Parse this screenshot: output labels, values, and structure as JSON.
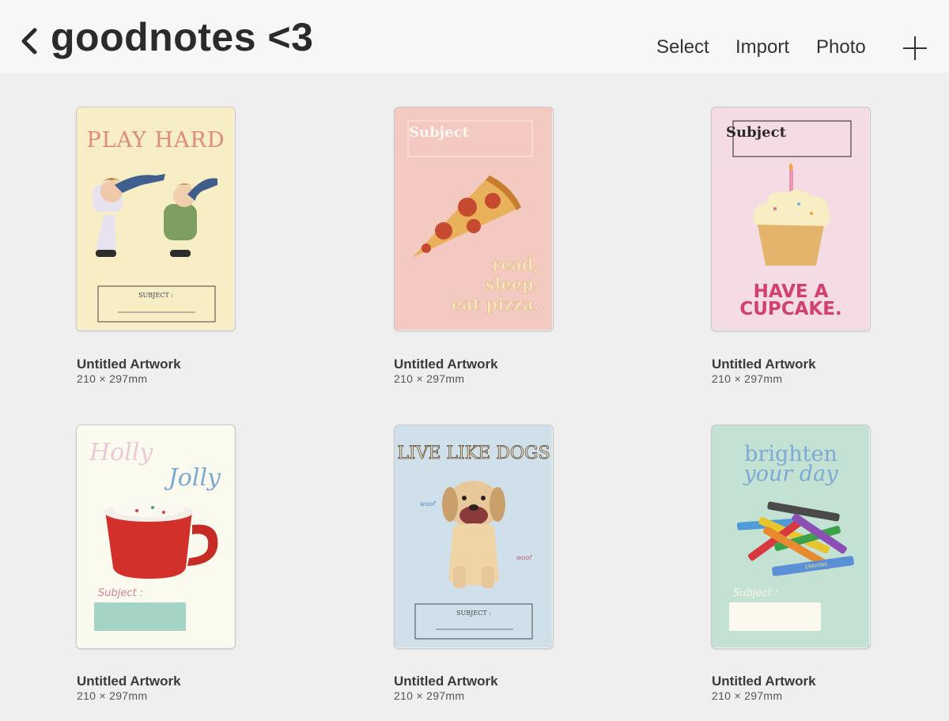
{
  "header": {
    "title": "goodnotes <3",
    "actions": [
      "Select",
      "Import",
      "Photo"
    ]
  },
  "artworks": [
    {
      "name": "Untitled Artwork",
      "size": "210 × 297mm",
      "bg": "#f7eec6",
      "cover": {
        "headline": "PLAY HARD",
        "label": "SUBJECT :"
      }
    },
    {
      "name": "Untitled Artwork",
      "size": "210 × 297mm",
      "bg": "#f4c9c2",
      "cover": {
        "label": "Subject",
        "line1": "read,",
        "line2": "sleep,",
        "line3": "eat pizza."
      }
    },
    {
      "name": "Untitled Artwork",
      "size": "210 × 297mm",
      "bg": "#f5dbe3",
      "cover": {
        "label": "Subject",
        "line1": "HAVE A",
        "line2": "CUPCAKE."
      }
    },
    {
      "name": "Untitled Artwork",
      "size": "210 × 297mm",
      "bg": "#fbfaee",
      "cover": {
        "line1": "Holly",
        "line2": "Jolly",
        "label": "Subject :"
      }
    },
    {
      "name": "Untitled Artwork",
      "size": "210 × 297mm",
      "bg": "#cfe0ea",
      "cover": {
        "headline": "LIVE LIKE DOGS",
        "woof1": "woof",
        "woof2": "woof",
        "label": "SUBJECT :"
      }
    },
    {
      "name": "Untitled Artwork",
      "size": "210 × 297mm",
      "bg": "#c3e2d4",
      "cover": {
        "line1": "brighten",
        "line2": "your day",
        "label": "Subject :",
        "crayon_text": "CRAYONS"
      }
    }
  ],
  "icons": {
    "back": "chevron-left-icon",
    "add": "plus-icon"
  },
  "colors": {
    "accent_text": "#2b2b2b",
    "background": "#efefef",
    "topbar": "#f7f7f7"
  }
}
